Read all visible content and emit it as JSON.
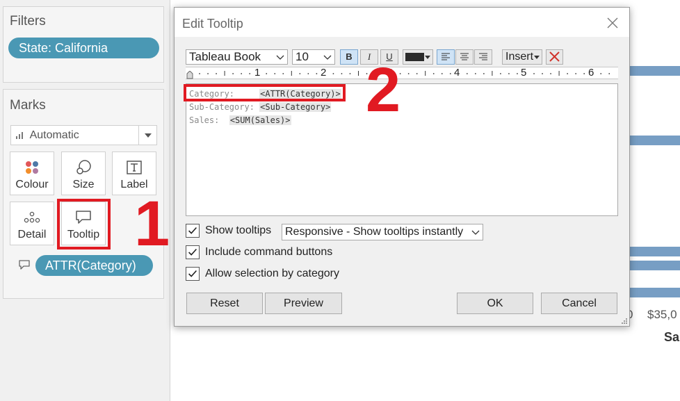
{
  "filters": {
    "title": "Filters",
    "pill": "State: California"
  },
  "marks": {
    "title": "Marks",
    "mark_type": "Automatic",
    "buttons": {
      "colour": "Colour",
      "size": "Size",
      "label": "Label",
      "detail": "Detail",
      "tooltip": "Tooltip"
    },
    "tooltip_pill": "ATTR(Category)"
  },
  "annotations": {
    "step1": "1",
    "step2": "2",
    "color": "#e11a22"
  },
  "chart": {
    "tick_labels": [
      "0",
      "$35,0"
    ],
    "axis_label": "Sa",
    "bar_color": "#779ec4"
  },
  "dialog": {
    "title": "Edit Tooltip",
    "toolbar": {
      "font_family": "Tableau Book",
      "font_size": "10",
      "bold": "B",
      "italic": "I",
      "underline": "U",
      "insert": "Insert"
    },
    "ruler_numbers": [
      "1",
      "2",
      "3",
      "4",
      "5",
      "6"
    ],
    "editor_lines": [
      {
        "label": "Category:",
        "field": "<ATTR(Category)>"
      },
      {
        "label": "Sub-Category:",
        "field": "<Sub-Category>"
      },
      {
        "label": "Sales:",
        "field": "<SUM(Sales)>"
      }
    ],
    "options": {
      "show_tooltips": "Show tooltips",
      "tooltip_mode": "Responsive - Show tooltips instantly",
      "include_command_buttons": "Include command buttons",
      "allow_selection": "Allow selection by category"
    },
    "buttons": {
      "reset": "Reset",
      "preview": "Preview",
      "ok": "OK",
      "cancel": "Cancel"
    }
  },
  "colors": {
    "pill": "#4a98b4",
    "accent_selected": "#cfe3f6"
  }
}
